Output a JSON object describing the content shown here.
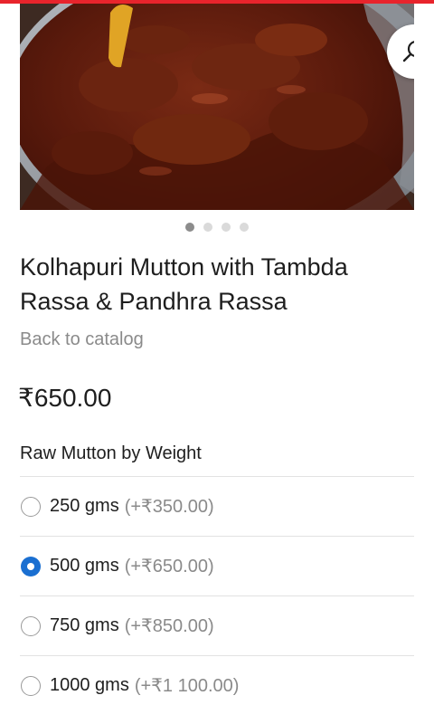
{
  "colors": {
    "accent_bar": "#e8242c",
    "radio_selected": "#1a6fd1",
    "muted_text": "#8a8a8a"
  },
  "hero": {
    "image_icon": "food-photo",
    "search_icon": "search-icon"
  },
  "carousel": {
    "total": 4,
    "active_index": 1
  },
  "product": {
    "title": "Kolhapuri Mutton with Tambda Rassa & Pandhra Rassa",
    "back_link": "Back to catalog",
    "price": "₹650.00"
  },
  "options": {
    "title": "Raw Mutton by Weight",
    "items": [
      {
        "label": "250 gms",
        "extra": "(+₹350.00)",
        "selected": false
      },
      {
        "label": "500 gms",
        "extra": "(+₹650.00)",
        "selected": true
      },
      {
        "label": "750 gms",
        "extra": "(+₹850.00)",
        "selected": false
      },
      {
        "label": "1000 gms",
        "extra": "(+₹1 100.00)",
        "selected": false
      }
    ]
  }
}
